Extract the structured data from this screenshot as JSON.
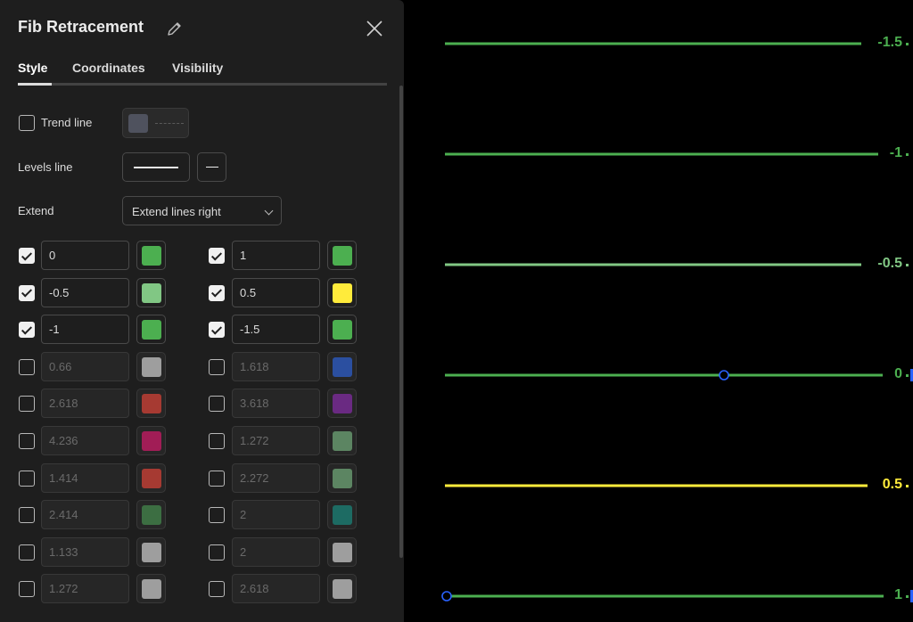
{
  "dialog": {
    "title": "Fib Retracement",
    "tabs": [
      {
        "label": "Style",
        "active": true
      },
      {
        "label": "Coordinates",
        "active": false
      },
      {
        "label": "Visibility",
        "active": false
      }
    ],
    "trend_line": {
      "label": "Trend line",
      "checked": false,
      "color": "#4f525e"
    },
    "levels_line": {
      "label": "Levels line"
    },
    "extend": {
      "label": "Extend",
      "value": "Extend lines right"
    },
    "levels": [
      {
        "value": "0",
        "color": "#4caf50",
        "checked": true
      },
      {
        "value": "1",
        "color": "#4caf50",
        "checked": true
      },
      {
        "value": "-0.5",
        "color": "#81c784",
        "checked": true
      },
      {
        "value": "0.5",
        "color": "#ffeb3b",
        "checked": true
      },
      {
        "value": "-1",
        "color": "#4caf50",
        "checked": true
      },
      {
        "value": "-1.5",
        "color": "#4caf50",
        "checked": true
      },
      {
        "value": "0.66",
        "color": "#9e9e9e",
        "checked": false
      },
      {
        "value": "1.618",
        "color": "#2b4fa0",
        "checked": false
      },
      {
        "value": "2.618",
        "color": "#a63a32",
        "checked": false
      },
      {
        "value": "3.618",
        "color": "#6a2a82",
        "checked": false
      },
      {
        "value": "4.236",
        "color": "#a11d56",
        "checked": false
      },
      {
        "value": "1.272",
        "color": "#5c8562",
        "checked": false
      },
      {
        "value": "1.414",
        "color": "#a63a32",
        "checked": false
      },
      {
        "value": "2.272",
        "color": "#5c8562",
        "checked": false
      },
      {
        "value": "2.414",
        "color": "#3c6e42",
        "checked": false
      },
      {
        "value": "2",
        "color": "#1d6b63",
        "checked": false
      },
      {
        "value": "1.133",
        "color": "#9e9e9e",
        "checked": false
      },
      {
        "value": "2",
        "color": "#9e9e9e",
        "checked": false
      },
      {
        "value": "1.272",
        "color": "#9e9e9e",
        "checked": false
      },
      {
        "value": "2.618",
        "color": "#9e9e9e",
        "checked": false
      }
    ]
  },
  "chart": {
    "levels": [
      {
        "label": "-1.5",
        "color": "#4caf50"
      },
      {
        "label": "-1",
        "color": "#4caf50"
      },
      {
        "label": "-0.5",
        "color": "#81c784"
      },
      {
        "label": "0",
        "color": "#4caf50"
      },
      {
        "label": "0.5",
        "color": "#ffeb3b"
      },
      {
        "label": "1",
        "color": "#4caf50"
      }
    ],
    "handle_color": "#2962ff"
  }
}
